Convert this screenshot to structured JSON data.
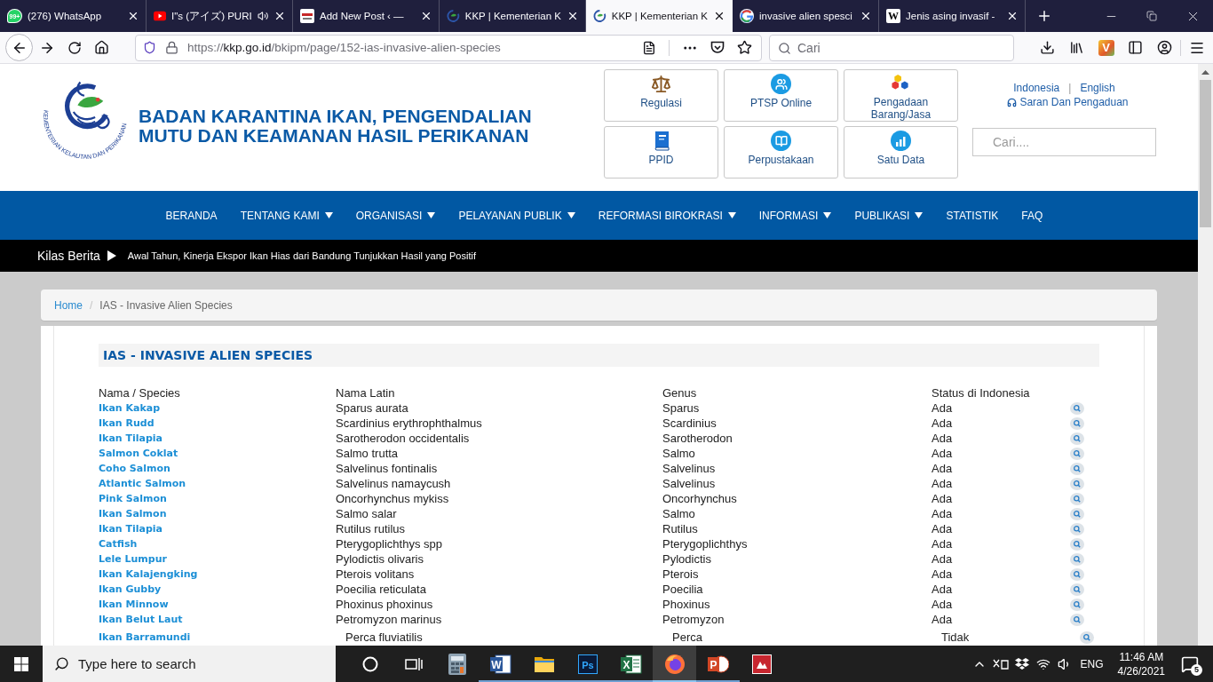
{
  "browser": {
    "tabs": [
      {
        "kind": "whatsapp",
        "badge": "99+",
        "title": "(276) WhatsApp",
        "audio": false,
        "selected": false
      },
      {
        "kind": "youtube",
        "title": "I\"s (アイズ) PURI",
        "audio": true,
        "selected": false
      },
      {
        "kind": "post",
        "title": "Add New Post ‹ —",
        "audio": false,
        "selected": false
      },
      {
        "kind": "ministry",
        "title": "KKP | Kementerian K",
        "audio": false,
        "selected": false
      },
      {
        "kind": "ministry",
        "title": "KKP | Kementerian K",
        "audio": false,
        "selected": true
      },
      {
        "kind": "google",
        "title": "invasive alien spesci",
        "audio": false,
        "selected": false
      },
      {
        "kind": "wikipedia",
        "glyph": "W",
        "title": "Jenis asing invasif -",
        "audio": false,
        "selected": false
      }
    ],
    "address": {
      "scheme": "https://",
      "host": "kkp.go.id",
      "path": "/bkipm/page/152-ias-invasive-alien-species"
    },
    "search": {
      "placeholder": "Cari"
    },
    "extension": {
      "glyph": "V"
    }
  },
  "header": {
    "logo_caption": "KEMENTERIAN KELAUTAN DAN PERIKANAN",
    "title_lines": [
      "BADAN KARANTINA IKAN, PENGENDALIAN",
      "MUTU DAN KEAMANAN HASIL PERIKANAN"
    ],
    "quick_links": [
      {
        "kind": "scales",
        "label": "Regulasi"
      },
      {
        "kind": "people",
        "label": "PTSP Online"
      },
      {
        "kind": "hexagons",
        "label": "Pengadaan Barang/Jasa"
      },
      {
        "kind": "book",
        "label": "PPID"
      },
      {
        "kind": "library",
        "label": "Perpustakaan"
      },
      {
        "kind": "chart",
        "label": "Satu Data"
      }
    ],
    "languages": [
      "Indonesia",
      "English"
    ],
    "language_separator": "|",
    "feedback_link": "Saran Dan Pengaduan",
    "search": {
      "placeholder": "Cari...."
    }
  },
  "nav": {
    "items": [
      {
        "label": "BERANDA",
        "dropdown": false
      },
      {
        "label": "TENTANG KAMI",
        "dropdown": true
      },
      {
        "label": "ORGANISASI",
        "dropdown": true
      },
      {
        "label": "PELAYANAN PUBLIK",
        "dropdown": true
      },
      {
        "label": "REFORMASI BIROKRASI",
        "dropdown": true
      },
      {
        "label": "INFORMASI",
        "dropdown": true
      },
      {
        "label": "PUBLIKASI",
        "dropdown": true
      },
      {
        "label": "STATISTIK",
        "dropdown": false
      },
      {
        "label": "FAQ",
        "dropdown": false
      }
    ]
  },
  "ticker": {
    "label": "Kilas Berita",
    "headline": "Awal Tahun, Kinerja Ekspor Ikan Hias dari Bandung Tunjukkan Hasil yang Positif"
  },
  "breadcrumb": {
    "items": [
      "Home",
      "IAS - Invasive Alien Species"
    ],
    "separator": "/"
  },
  "content": {
    "title": "IAS - INVASIVE ALIEN SPECIES",
    "table": {
      "columns": [
        "Nama / Species",
        "Nama Latin",
        "Genus",
        "Status di Indonesia"
      ],
      "rows": [
        {
          "kind": "standard",
          "name": "Ikan Kakap",
          "latin": "Sparus aurata",
          "genus": "Sparus",
          "status": "Ada"
        },
        {
          "kind": "standard",
          "name": "Ikan Rudd",
          "latin": "Scardinius erythrophthalmus",
          "genus": "Scardinius",
          "status": "Ada"
        },
        {
          "kind": "standard",
          "name": "Ikan Tilapia",
          "latin": "Sarotherodon occidentalis",
          "genus": "Sarotherodon",
          "status": "Ada"
        },
        {
          "kind": "standard",
          "name": "Salmon Coklat",
          "latin": "Salmo trutta",
          "genus": "Salmo",
          "status": "Ada"
        },
        {
          "kind": "standard",
          "name": "Coho Salmon",
          "latin": "Salvelinus fontinalis",
          "genus": "Salvelinus",
          "status": "Ada"
        },
        {
          "kind": "standard",
          "name": "Atlantic Salmon",
          "latin": "Salvelinus namaycush",
          "genus": "Salvelinus",
          "status": "Ada"
        },
        {
          "kind": "standard",
          "name": "Pink Salmon",
          "latin": "Oncorhynchus mykiss",
          "genus": "Oncorhynchus",
          "status": "Ada"
        },
        {
          "kind": "standard",
          "name": "Ikan Salmon",
          "latin": "Salmo salar",
          "genus": "Salmo",
          "status": "Ada"
        },
        {
          "kind": "standard",
          "name": "Ikan Tilapia",
          "latin": "Rutilus rutilus",
          "genus": "Rutilus",
          "status": "Ada"
        },
        {
          "kind": "standard",
          "name": "Catfish",
          "latin": "Pterygoplichthys spp",
          "genus": "Pterygoplichthys",
          "status": "Ada"
        },
        {
          "kind": "standard",
          "name": "Lele Lumpur",
          "latin": "Pylodictis olivaris",
          "genus": "Pylodictis",
          "status": "Ada"
        },
        {
          "kind": "standard",
          "name": "Ikan Kalajengking",
          "latin": "Pterois volitans",
          "genus": "Pterois",
          "status": "Ada"
        },
        {
          "kind": "standard",
          "name": "Ikan Gubby",
          "latin": "Poecilia reticulata",
          "genus": "Poecilia",
          "status": "Ada"
        },
        {
          "kind": "standard",
          "name": "Ikan Minnow",
          "latin": "Phoxinus phoxinus",
          "genus": "Phoxinus",
          "status": "Ada"
        },
        {
          "kind": "standard",
          "name": "Ikan Belut Laut",
          "latin": "Petromyzon marinus",
          "genus": "Petromyzon",
          "status": "Ada"
        },
        {
          "kind": "indented",
          "name": "Ikan Barramundi",
          "latin": "Perca fluviatilis",
          "genus": "Perca",
          "status": "Tidak"
        }
      ]
    }
  },
  "taskbar": {
    "search": {
      "placeholder": "Type here to search"
    },
    "apps": [
      {
        "kind": "cortana",
        "running": false,
        "selected": false
      },
      {
        "kind": "task-view",
        "running": false,
        "selected": false
      },
      {
        "kind": "calculator",
        "running": false,
        "selected": false
      },
      {
        "kind": "word",
        "glyph": "W",
        "running": true,
        "selected": false
      },
      {
        "kind": "explorer",
        "running": true,
        "selected": false
      },
      {
        "kind": "photoshop",
        "glyph": "Ps",
        "running": true,
        "selected": false
      },
      {
        "kind": "excel",
        "glyph": "X",
        "running": true,
        "selected": false
      },
      {
        "kind": "firefox",
        "running": true,
        "selected": true
      },
      {
        "kind": "powerpoint",
        "glyph": "P",
        "running": true,
        "selected": false
      },
      {
        "kind": "pdf",
        "running": false,
        "selected": false
      }
    ],
    "language": "ENG",
    "time": "11:46 AM",
    "date": "4/26/2021",
    "notifications": "5"
  }
}
